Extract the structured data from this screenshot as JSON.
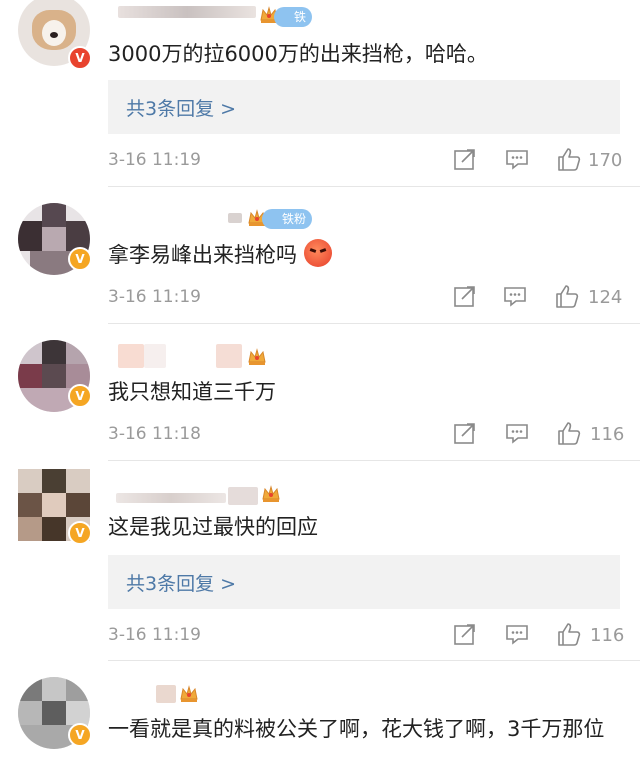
{
  "comments": [
    {
      "id": "c1",
      "text": "3000万的拉6000万的出来挡枪，哈哈。",
      "badge": "铁粉",
      "replies_label": "共3条回复 >",
      "time": "3-16 11:19",
      "likes": "170"
    },
    {
      "id": "c2",
      "text": "拿李易峰出来挡枪吗",
      "emoji": "angry-face-emoji",
      "badge": "铁粉",
      "time": "3-16 11:19",
      "likes": "124"
    },
    {
      "id": "c3",
      "text": "我只想知道三千万",
      "time": "3-16 11:18",
      "likes": "116"
    },
    {
      "id": "c4",
      "text": "这是我见过最快的回应",
      "replies_label": "共3条回复 >",
      "time": "3-16 11:19",
      "likes": "116"
    },
    {
      "id": "c5",
      "text": "一看就是真的料被公关了啊，花大钱了啊，3千万那位"
    }
  ],
  "icons": [
    "share-icon",
    "comment-icon",
    "like-icon",
    "crown-icon",
    "verified-badge-icon"
  ],
  "colors": {
    "link": "#4e79a7",
    "meta_text": "#9a9a9a",
    "reply_bg": "#f2f2f2",
    "badge_blue": "#8ec3f0",
    "verified_red": "#e8432e",
    "verified_yellow": "#f5a623",
    "crown_gold": "#f0a93a"
  }
}
